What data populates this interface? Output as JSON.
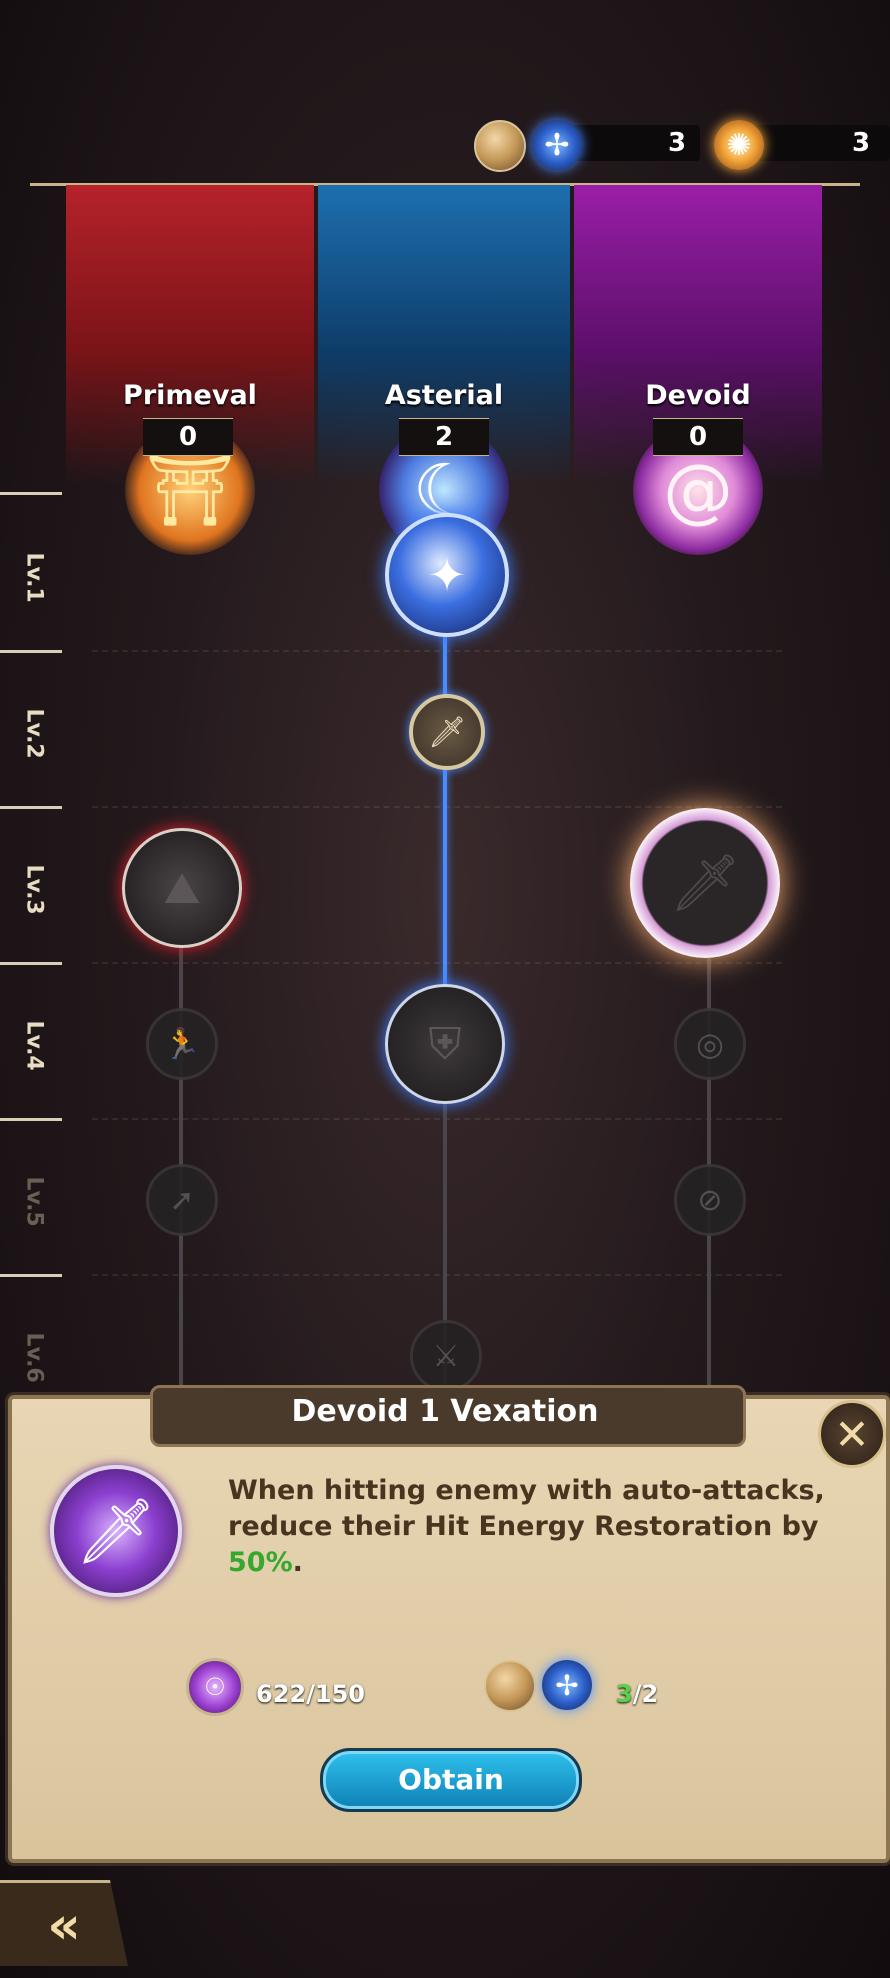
{
  "resources": {
    "blue_count": "3",
    "gold_count": "3"
  },
  "factions": [
    {
      "name": "Primeval",
      "count": "0"
    },
    {
      "name": "Asterial",
      "count": "2"
    },
    {
      "name": "Devoid",
      "count": "0"
    }
  ],
  "levels": [
    "Lv.1",
    "Lv.2",
    "Lv.3",
    "Lv.4",
    "Lv.5",
    "Lv.6"
  ],
  "skill_popup": {
    "title": "Devoid 1 Vexation",
    "description_pre": "When hitting enemy with auto-attacks, reduce their Hit Energy Restoration by ",
    "description_value": "50%",
    "description_post": ".",
    "cost_item": "622/150",
    "cost_req_have": "3",
    "cost_req_need": "/2",
    "obtain_label": "Obtain"
  },
  "colors": {
    "primeval": "#b6222a",
    "asterial": "#1d6fb0",
    "devoid": "#9a1ea8",
    "highlight": "#36a82e",
    "obtain_button": "#2ec2ee"
  }
}
